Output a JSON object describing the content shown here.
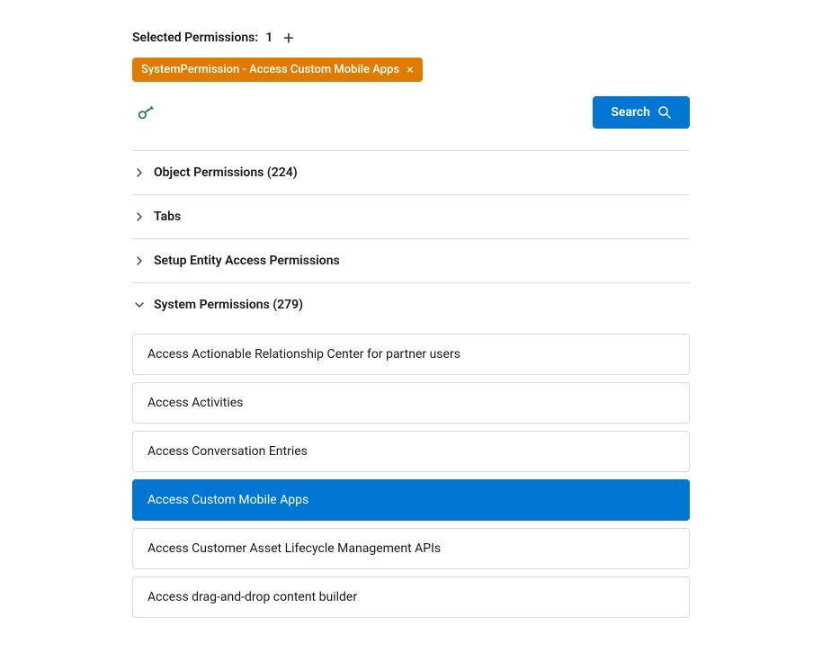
{
  "header": {
    "selected_permissions_label": "Selected Permissions:",
    "selected_count": "1",
    "add_icon": "+"
  },
  "tag": {
    "label": "SystemPermission - Access Custom Mobile Apps",
    "close_icon": "×"
  },
  "search": {
    "button_label": "Search"
  },
  "sections": [
    {
      "id": "object-permissions",
      "label": "Object Permissions (224)",
      "expanded": false
    },
    {
      "id": "tabs",
      "label": "Tabs",
      "expanded": false
    },
    {
      "id": "setup-entity",
      "label": "Setup Entity Access Permissions",
      "expanded": false
    },
    {
      "id": "system-permissions",
      "label": "System Permissions (279)",
      "expanded": true
    }
  ],
  "permission_items": [
    {
      "id": "item-1",
      "label": "Access Actionable Relationship Center for partner users",
      "selected": false
    },
    {
      "id": "item-2",
      "label": "Access Activities",
      "selected": false
    },
    {
      "id": "item-3",
      "label": "Access Conversation Entries",
      "selected": false
    },
    {
      "id": "item-4",
      "label": "Access Custom Mobile Apps",
      "selected": true
    },
    {
      "id": "item-5",
      "label": "Access Customer Asset Lifecycle Management APIs",
      "selected": false
    },
    {
      "id": "item-6",
      "label": "Access drag-and-drop content builder",
      "selected": false
    }
  ]
}
